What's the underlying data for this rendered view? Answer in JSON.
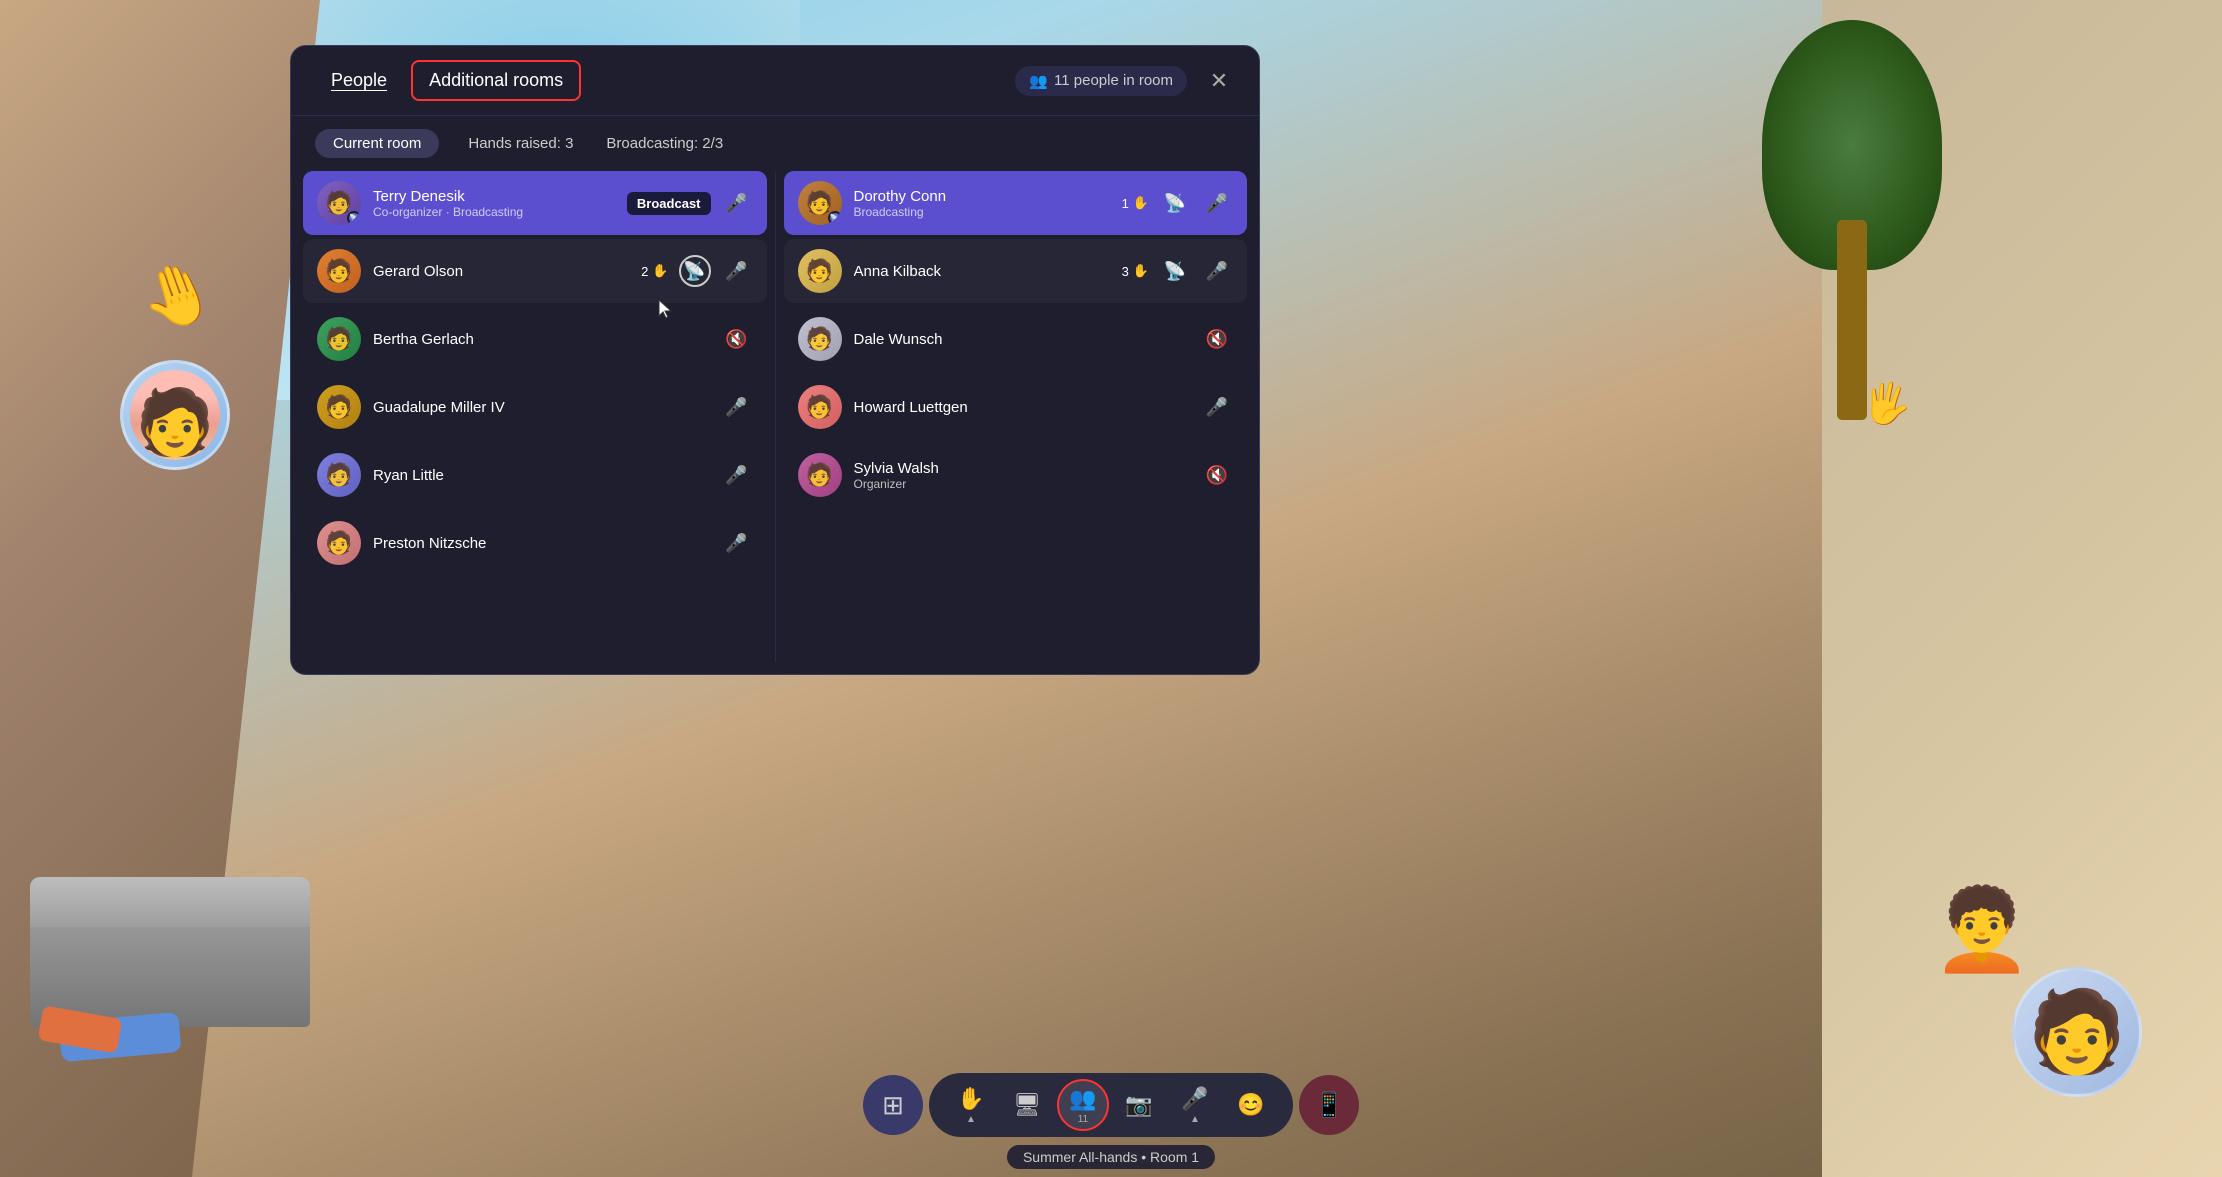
{
  "background": {
    "color": "#1a1a2e"
  },
  "panel": {
    "tabs": [
      {
        "id": "people",
        "label": "People",
        "active": true,
        "highlighted": false
      },
      {
        "id": "additional-rooms",
        "label": "Additional rooms",
        "active": false,
        "highlighted": true
      }
    ],
    "people_count": "11 people in room",
    "close_label": "✕",
    "filters": [
      {
        "id": "current-room",
        "label": "Current room",
        "active": true
      },
      {
        "id": "hands-raised",
        "label": "Hands raised: 3",
        "active": false
      },
      {
        "id": "broadcasting",
        "label": "Broadcasting: 2/3",
        "active": false
      }
    ],
    "left_column": [
      {
        "id": "terry",
        "name": "Terry Denesik",
        "role": "Co-organizer · Broadcasting",
        "avatar_class": "av-terry",
        "avatar_icon": "👤",
        "broadcasting": true,
        "has_broadcast_badge": true,
        "broadcast_badge_label": "Broadcast",
        "has_mic": false,
        "hand_count": null,
        "has_broadcast_icon": false
      },
      {
        "id": "gerard",
        "name": "Gerard Olson",
        "role": "",
        "avatar_class": "av-gerard",
        "avatar_icon": "👤",
        "broadcasting": false,
        "has_broadcast_badge": false,
        "broadcast_badge_label": "",
        "has_mic": true,
        "hand_count": 2,
        "has_broadcast_icon": true,
        "broadcast_icon_active": true
      },
      {
        "id": "bertha",
        "name": "Bertha Gerlach",
        "role": "",
        "avatar_class": "av-bertha",
        "avatar_icon": "👤",
        "broadcasting": false,
        "has_broadcast_badge": false,
        "broadcast_badge_label": "",
        "has_mic": false,
        "hand_count": null,
        "has_broadcast_icon": false,
        "mic_muted": true
      },
      {
        "id": "guadalupe",
        "name": "Guadalupe Miller IV",
        "role": "",
        "avatar_class": "av-guadalupe",
        "avatar_icon": "👤",
        "broadcasting": false,
        "has_broadcast_badge": false,
        "broadcast_badge_label": "",
        "has_mic": true,
        "hand_count": null,
        "has_broadcast_icon": false
      },
      {
        "id": "ryan",
        "name": "Ryan Little",
        "role": "",
        "avatar_class": "av-ryan",
        "avatar_icon": "👤",
        "broadcasting": false,
        "has_broadcast_badge": false,
        "broadcast_badge_label": "",
        "has_mic": true,
        "hand_count": null,
        "has_broadcast_icon": false
      },
      {
        "id": "preston",
        "name": "Preston Nitzsche",
        "role": "",
        "avatar_class": "av-preston",
        "avatar_icon": "👤",
        "broadcasting": false,
        "has_broadcast_badge": false,
        "broadcast_badge_label": "",
        "has_mic": true,
        "hand_count": null,
        "has_broadcast_icon": false
      }
    ],
    "right_column": [
      {
        "id": "dorothy",
        "name": "Dorothy Conn",
        "role": "Broadcasting",
        "avatar_class": "av-dorothy",
        "avatar_icon": "👤",
        "broadcasting": true,
        "has_broadcast_badge": false,
        "broadcast_badge_label": "",
        "has_mic": true,
        "hand_count": 1,
        "has_broadcast_icon": true
      },
      {
        "id": "anna",
        "name": "Anna Kilback",
        "role": "",
        "avatar_class": "av-anna",
        "avatar_icon": "👤",
        "broadcasting": false,
        "has_broadcast_badge": false,
        "broadcast_badge_label": "",
        "has_mic": true,
        "hand_count": 3,
        "has_broadcast_icon": true
      },
      {
        "id": "dale",
        "name": "Dale Wunsch",
        "role": "",
        "avatar_class": "av-dale",
        "avatar_icon": "👤",
        "broadcasting": false,
        "has_broadcast_badge": false,
        "broadcast_badge_label": "",
        "has_mic": false,
        "hand_count": null,
        "has_broadcast_icon": false,
        "mic_muted": true
      },
      {
        "id": "howard",
        "name": "Howard Luettgen",
        "role": "",
        "avatar_class": "av-howard",
        "avatar_icon": "👤",
        "broadcasting": false,
        "has_broadcast_badge": false,
        "broadcast_badge_label": "",
        "has_mic": true,
        "hand_count": null,
        "has_broadcast_icon": false
      },
      {
        "id": "sylvia",
        "name": "Sylvia Walsh",
        "role": "Organizer",
        "avatar_class": "av-sylvia",
        "avatar_icon": "👤",
        "broadcasting": false,
        "has_broadcast_badge": false,
        "broadcast_badge_label": "",
        "has_mic": false,
        "hand_count": null,
        "has_broadcast_icon": false,
        "mic_muted": true
      }
    ]
  },
  "toolbar": {
    "buttons": [
      {
        "id": "raise-hand",
        "icon": "✋",
        "label": "",
        "highlighted": false
      },
      {
        "id": "screen-share",
        "icon": "🖥",
        "label": "",
        "highlighted": false
      },
      {
        "id": "people",
        "icon": "👥",
        "label": "11",
        "highlighted": true
      },
      {
        "id": "camera",
        "icon": "📷",
        "label": "",
        "highlighted": false
      },
      {
        "id": "mic",
        "icon": "🎤",
        "label": "",
        "highlighted": false
      },
      {
        "id": "emoji",
        "icon": "😊",
        "label": "",
        "highlighted": false
      }
    ],
    "end_call_icon": "📱",
    "grid_icon": "⊞",
    "room_label": "Summer All-hands • Room 1"
  }
}
